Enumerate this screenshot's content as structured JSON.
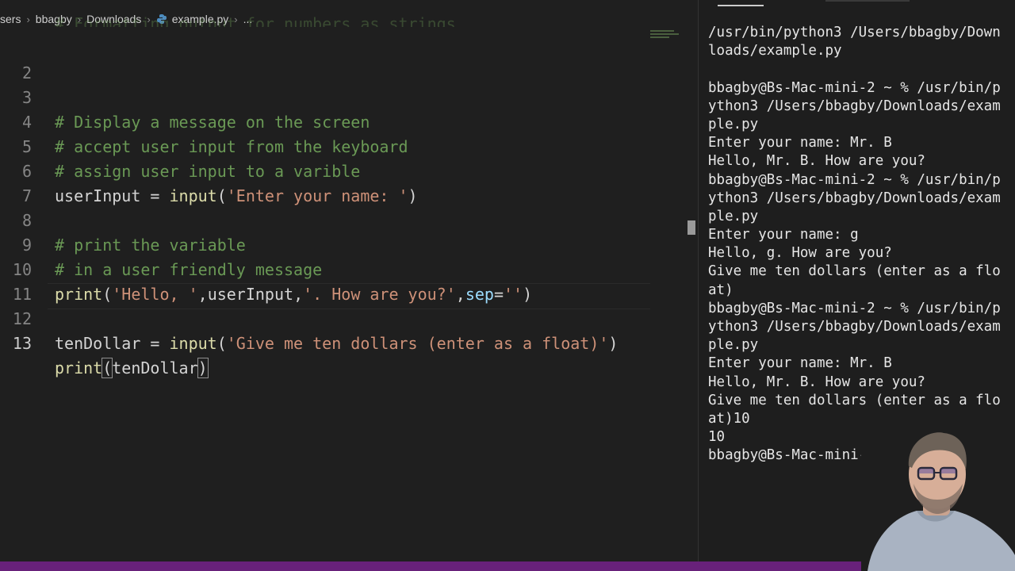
{
  "breadcrumb": {
    "items": [
      "sers",
      "bbagby",
      "Downloads",
      "example.py",
      "..."
    ]
  },
  "editor": {
    "scrolled_partial_line": "# Formatting output for numbers as strings",
    "lines": [
      {
        "n": "2"
      },
      {
        "n": "3"
      },
      {
        "n": "4"
      },
      {
        "n": "5"
      },
      {
        "n": "6"
      },
      {
        "n": "7"
      },
      {
        "n": "8"
      },
      {
        "n": "9"
      },
      {
        "n": "10"
      },
      {
        "n": "11"
      },
      {
        "n": "12"
      },
      {
        "n": "13"
      }
    ],
    "code": {
      "l3": "# Display a message on the screen",
      "l4": "# accept user input from the keyboard",
      "l5": "# assign user input to a varible",
      "l6_var": "userInput",
      "l6_eq": " = ",
      "l6_fn": "input",
      "l6_open": "(",
      "l6_str": "'Enter your name: '",
      "l6_close": ")",
      "l8": "# print the variable",
      "l9": "# in a user friendly message",
      "l10_fn": "print",
      "l10_open": "(",
      "l10_s1": "'Hello, '",
      "l10_c1": ",",
      "l10_var": "userInput",
      "l10_c2": ",",
      "l10_s2": "'. How are you?'",
      "l10_c3": ",",
      "l10_param": "sep",
      "l10_eq": "=",
      "l10_s3": "''",
      "l10_close": ")",
      "l12_var": "tenDollar",
      "l12_eq": " = ",
      "l12_fn": "input",
      "l12_open": "(",
      "l12_str": "'Give me ten dollars (enter as a float)'",
      "l12_close": ")",
      "l13_fn": "print",
      "l13_open": "(",
      "l13_var": "tenDollar",
      "l13_close": ")"
    }
  },
  "terminal": {
    "lines": [
      "/usr/bin/python3 /Users/bbagby/Down",
      "loads/example.py",
      "",
      "bbagby@Bs-Mac-mini-2 ~ % /usr/bin/p",
      "ython3 /Users/bbagby/Downloads/exam",
      "ple.py",
      "Enter your name: Mr. B",
      "Hello, Mr. B. How are you?",
      "bbagby@Bs-Mac-mini-2 ~ % /usr/bin/p",
      "ython3 /Users/bbagby/Downloads/exam",
      "ple.py",
      "Enter your name: g",
      "Hello, g. How are you?",
      "Give me ten dollars (enter as a flo",
      "at)",
      "bbagby@Bs-Mac-mini-2 ~ % /usr/bin/p",
      "ython3 /Users/bbagby/Downloads/exam",
      "ple.py",
      "Enter your name: Mr. B",
      "Hello, Mr. B. How are you?",
      "Give me ten dollars (enter as a flo",
      "at)10",
      "10",
      "bbagby@Bs-Mac-mini-2 ~ % "
    ]
  },
  "colors": {
    "status_bar": "#68217a",
    "comment": "#6a9955",
    "string": "#ce9178",
    "function": "#dcdcaa",
    "parameter": "#9cdcfe"
  }
}
